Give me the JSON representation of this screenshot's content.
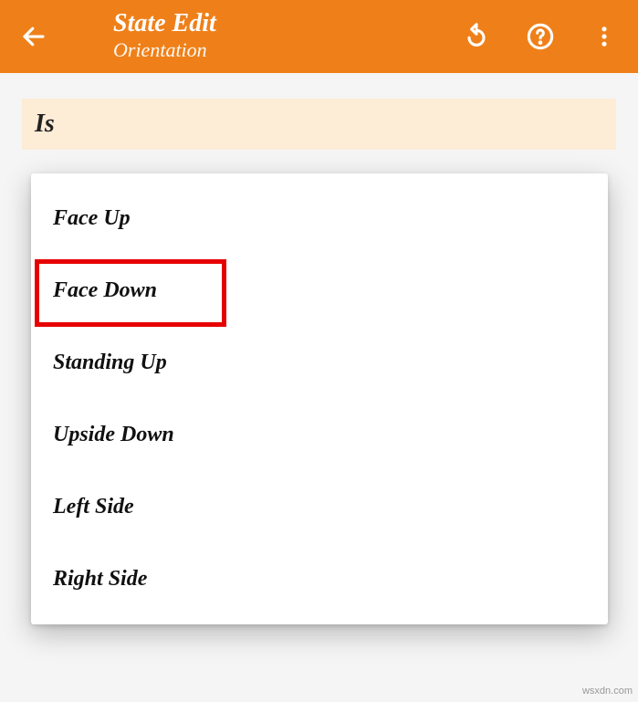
{
  "appbar": {
    "title": "State Edit",
    "subtitle": "Orientation"
  },
  "section": {
    "label": "Is"
  },
  "options": [
    "Face Up",
    "Face Down",
    "Standing Up",
    "Upside Down",
    "Left Side",
    "Right Side"
  ],
  "highlight_index": 1,
  "watermark": "wsxdn.com",
  "colors": {
    "accent": "#ef8019",
    "section_bg": "#fdecd6",
    "highlight": "#e60000"
  }
}
